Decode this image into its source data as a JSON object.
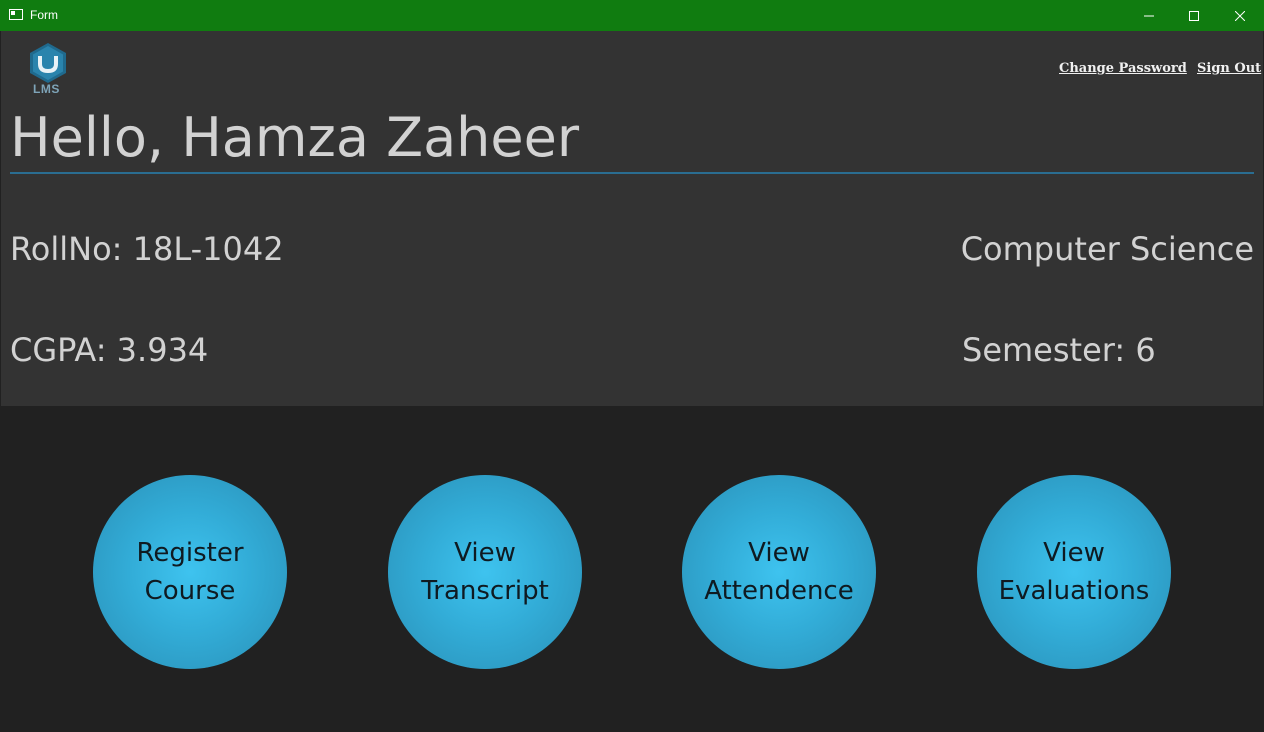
{
  "window": {
    "title": "Form",
    "controls": [
      "minimize",
      "maximize",
      "close"
    ]
  },
  "logo": {
    "text": "LMS",
    "icon": "lms-hexagon-logo-icon"
  },
  "header": {
    "links": {
      "change_password": "Change Password",
      "sign_out": "Sign Out"
    },
    "greeting": "Hello, Hamza Zaheer"
  },
  "student": {
    "roll_no": "RollNo: 18L-1042",
    "department": "Computer Science",
    "cgpa": "CGPA: 3.934",
    "semester": "Semester: 6"
  },
  "actions": [
    {
      "line1": "Register",
      "line2": "Course"
    },
    {
      "line1": "View",
      "line2": "Transcript"
    },
    {
      "line1": "View",
      "line2": "Attendence"
    },
    {
      "line1": "View",
      "line2": "Evaluations"
    }
  ],
  "colors": {
    "titlebar": "#107c10",
    "header_bg": "#333333",
    "body_bg": "#212121",
    "accent": "#32acd7",
    "divider": "#2a6d91"
  }
}
